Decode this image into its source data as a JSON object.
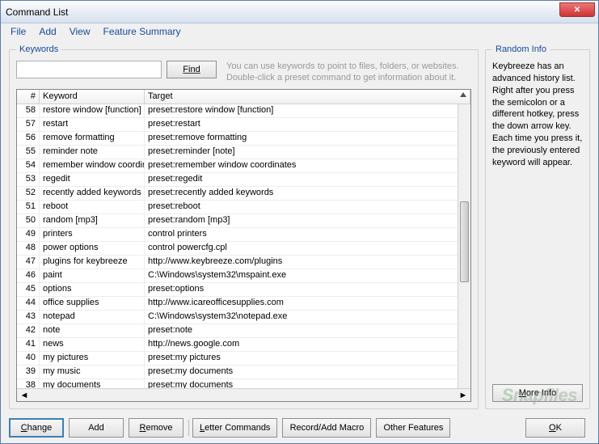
{
  "window": {
    "title": "Command List"
  },
  "menu": {
    "file": "File",
    "add": "Add",
    "view": "View",
    "summary": "Feature Summary"
  },
  "keywords": {
    "legend": "Keywords",
    "find_label": "Find",
    "hint": "You can use keywords to point to files, folders, or websites. Double-click a preset command to get information about it.",
    "headers": {
      "num": "#",
      "keyword": "Keyword",
      "target": "Target"
    },
    "rows": [
      {
        "n": "38",
        "kw": "my documents",
        "tg": "preset:my documents"
      },
      {
        "n": "39",
        "kw": "my music",
        "tg": "preset:my documents"
      },
      {
        "n": "40",
        "kw": "my pictures",
        "tg": "preset:my pictures"
      },
      {
        "n": "41",
        "kw": "news",
        "tg": "http://news.google.com"
      },
      {
        "n": "42",
        "kw": "note",
        "tg": "preset:note"
      },
      {
        "n": "43",
        "kw": "notepad",
        "tg": "C:\\Windows\\system32\\notepad.exe"
      },
      {
        "n": "44",
        "kw": "office supplies",
        "tg": "http://www.icareofficesupplies.com"
      },
      {
        "n": "45",
        "kw": "options",
        "tg": "preset:options"
      },
      {
        "n": "46",
        "kw": "paint",
        "tg": "C:\\Windows\\system32\\mspaint.exe"
      },
      {
        "n": "47",
        "kw": "plugins for keybreeze",
        "tg": "http://www.keybreeze.com/plugins"
      },
      {
        "n": "48",
        "kw": "power options",
        "tg": "control powercfg.cpl"
      },
      {
        "n": "49",
        "kw": "printers",
        "tg": "control printers"
      },
      {
        "n": "50",
        "kw": "random [mp3]",
        "tg": "preset:random [mp3]"
      },
      {
        "n": "51",
        "kw": "reboot",
        "tg": "preset:reboot"
      },
      {
        "n": "52",
        "kw": "recently added keywords",
        "tg": "preset:recently added keywords"
      },
      {
        "n": "53",
        "kw": "regedit",
        "tg": "preset:regedit"
      },
      {
        "n": "54",
        "kw": "remember window coordin",
        "tg": "preset:remember window coordinates"
      },
      {
        "n": "55",
        "kw": "reminder note",
        "tg": "preset:reminder [note]"
      },
      {
        "n": "56",
        "kw": "remove formatting",
        "tg": "preset:remove formatting"
      },
      {
        "n": "57",
        "kw": "restart",
        "tg": "preset:restart"
      },
      {
        "n": "58",
        "kw": "restore window [function]",
        "tg": "preset:restore window [function]"
      }
    ]
  },
  "random": {
    "legend": "Random Info",
    "text": "Keybreeze has an advanced history list. Right after you press the semicolon or a different hotkey, press the down arrow key. Each time you press it, the previously entered keyword will appear.",
    "more": "More Info"
  },
  "buttons": {
    "change": "Change",
    "add": "Add",
    "remove": "Remove",
    "letter": "Letter Commands",
    "macro": "Record/Add Macro",
    "other": "Other Features",
    "ok": "OK"
  },
  "watermark": "Snapfiles"
}
